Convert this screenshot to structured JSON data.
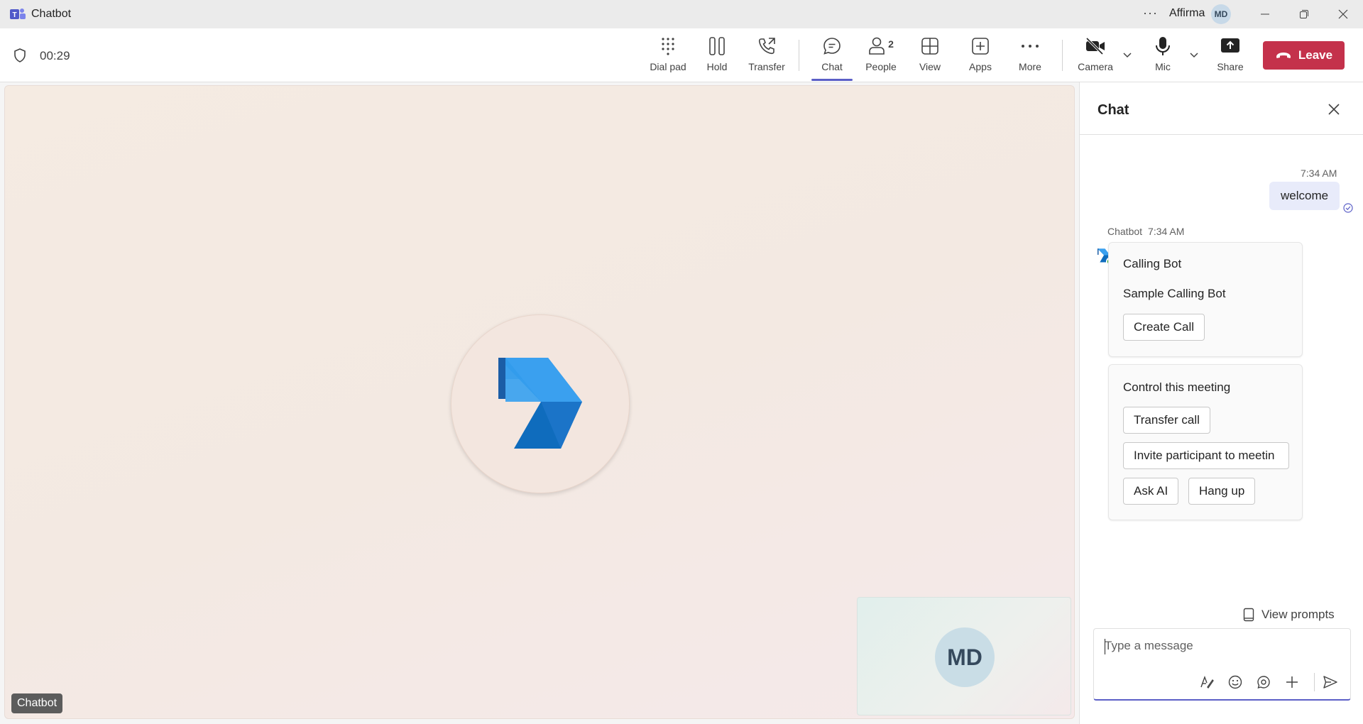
{
  "titlebar": {
    "app_title": "Chatbot",
    "more_label": "···",
    "user_name": "Affirma",
    "user_initials": "MD"
  },
  "toolbar": {
    "timer": "00:29",
    "tools": {
      "dialpad": "Dial pad",
      "hold": "Hold",
      "transfer": "Transfer",
      "chat": "Chat",
      "people": "People",
      "people_count": "2",
      "view": "View",
      "apps": "Apps",
      "more": "More",
      "camera": "Camera",
      "mic": "Mic",
      "share": "Share"
    },
    "leave_label": "Leave",
    "active_tab": "Chat",
    "colors": {
      "accent": "#5b5fc7",
      "leave": "#c4314b"
    }
  },
  "stage": {
    "participant_name": "Chatbot",
    "self_initials": "MD"
  },
  "chat": {
    "title": "Chat",
    "my_message": {
      "time": "7:34 AM",
      "text": "welcome"
    },
    "bot_message": {
      "sender": "Chatbot",
      "time": "7:34 AM",
      "card1": {
        "title": "Calling Bot",
        "subtitle": "Sample Calling Bot",
        "button": "Create Call"
      },
      "card2": {
        "title": "Control this meeting",
        "buttons": {
          "transfer": "Transfer call",
          "invite": "Invite participant to meetin",
          "ask_ai": "Ask AI",
          "hang_up": "Hang up"
        }
      }
    },
    "view_prompts": "View prompts",
    "compose_placeholder": "Type a message"
  }
}
